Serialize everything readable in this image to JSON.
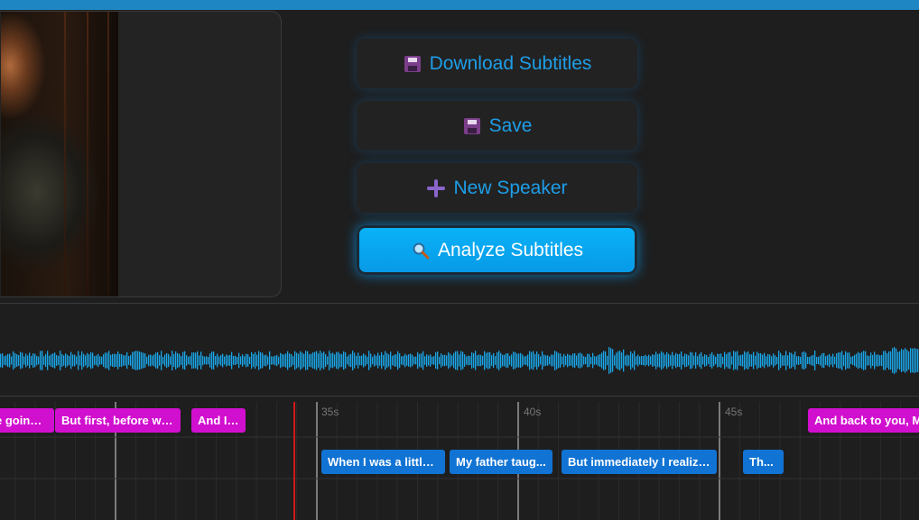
{
  "buttons": {
    "download": {
      "label": "Download Subtitles",
      "icon": "floppy-disk-icon"
    },
    "save": {
      "label": "Save",
      "icon": "floppy-disk-icon"
    },
    "new_speaker": {
      "label": "New Speaker",
      "icon": "plus-icon"
    },
    "analyze": {
      "label": "Analyze Subtitles",
      "icon": "magnifier-icon"
    }
  },
  "timeline": {
    "ticks": [
      "35s",
      "40s",
      "45s"
    ],
    "speaker1_cues": [
      "e going ...",
      "But first, before we...",
      "And I ...",
      "And back to you, M"
    ],
    "speaker2_cues": [
      "When I was a little ...",
      "My father taug...",
      "But immediately I realize...",
      "Th..."
    ]
  },
  "colors": {
    "accent": "#1e9ee8",
    "primary_button": "#0ab4f8",
    "speaker1": "#d10fcf",
    "speaker2": "#1173d4",
    "playhead": "#d01818",
    "waveform": "#1aa6e8"
  }
}
